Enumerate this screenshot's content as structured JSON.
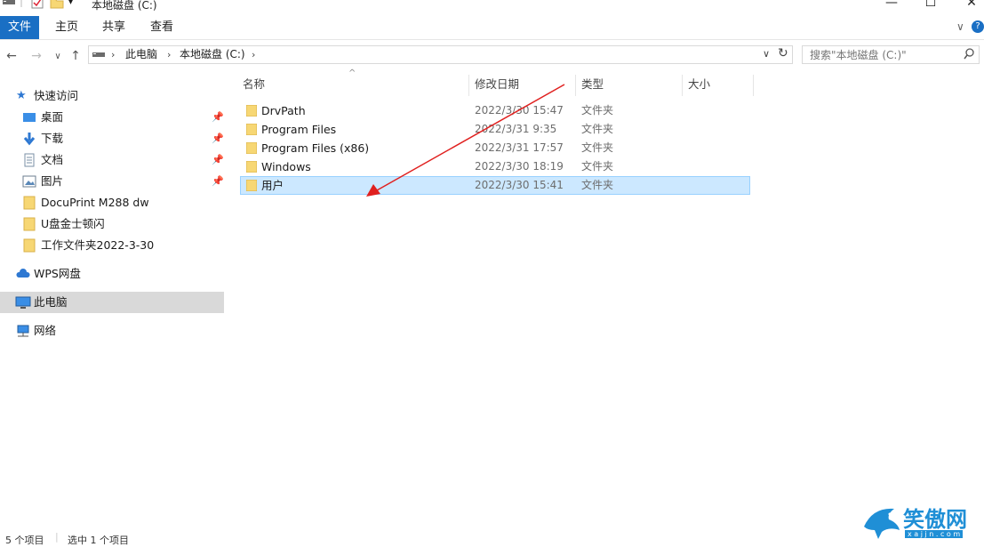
{
  "window": {
    "title": "本地磁盘 (C:)",
    "controls": {
      "minimize": "—",
      "maximize": "☐",
      "close": "✕"
    }
  },
  "ribbon": {
    "tabs": [
      "文件",
      "主页",
      "共享",
      "查看"
    ],
    "chevron": "∨",
    "help": "?"
  },
  "address": {
    "path": [
      "此电脑",
      "本地磁盘 (C:)"
    ],
    "dropdown": "∨",
    "refresh": "↻"
  },
  "search": {
    "placeholder": "搜索\"本地磁盘 (C:)\""
  },
  "nav": {
    "quick_access": "快速访问",
    "pinned": [
      {
        "label": "桌面",
        "icon": "desktop-icon"
      },
      {
        "label": "下载",
        "icon": "download-icon"
      },
      {
        "label": "文档",
        "icon": "document-icon"
      },
      {
        "label": "图片",
        "icon": "picture-icon"
      }
    ],
    "recent": [
      {
        "label": "DocuPrint M288 dw"
      },
      {
        "label": "U盘金士顿闪"
      },
      {
        "label": "工作文件夹2022-3-30"
      }
    ],
    "wps": "WPS网盘",
    "this_pc": "此电脑",
    "network": "网络"
  },
  "columns": {
    "name": "名称",
    "date": "修改日期",
    "type": "类型",
    "size": "大小"
  },
  "files": [
    {
      "name": "DrvPath",
      "date": "2022/3/30 15:47",
      "type": "文件夹",
      "selected": false
    },
    {
      "name": "Program Files",
      "date": "2022/3/31 9:35",
      "type": "文件夹",
      "selected": false
    },
    {
      "name": "Program Files (x86)",
      "date": "2022/3/31 17:57",
      "type": "文件夹",
      "selected": false
    },
    {
      "name": "Windows",
      "date": "2022/3/30 18:19",
      "type": "文件夹",
      "selected": false
    },
    {
      "name": "用户",
      "date": "2022/3/30 15:41",
      "type": "文件夹",
      "selected": true
    }
  ],
  "status": {
    "items": "5 个项目",
    "selected": "选中 1 个项目"
  },
  "watermark": {
    "text": "笑傲网",
    "url": "x a j j n . c o m"
  },
  "colors": {
    "accent": "#1a6fc4",
    "selection": "#cce8ff",
    "arrow": "#e0201f",
    "folder": "#f7d774"
  }
}
